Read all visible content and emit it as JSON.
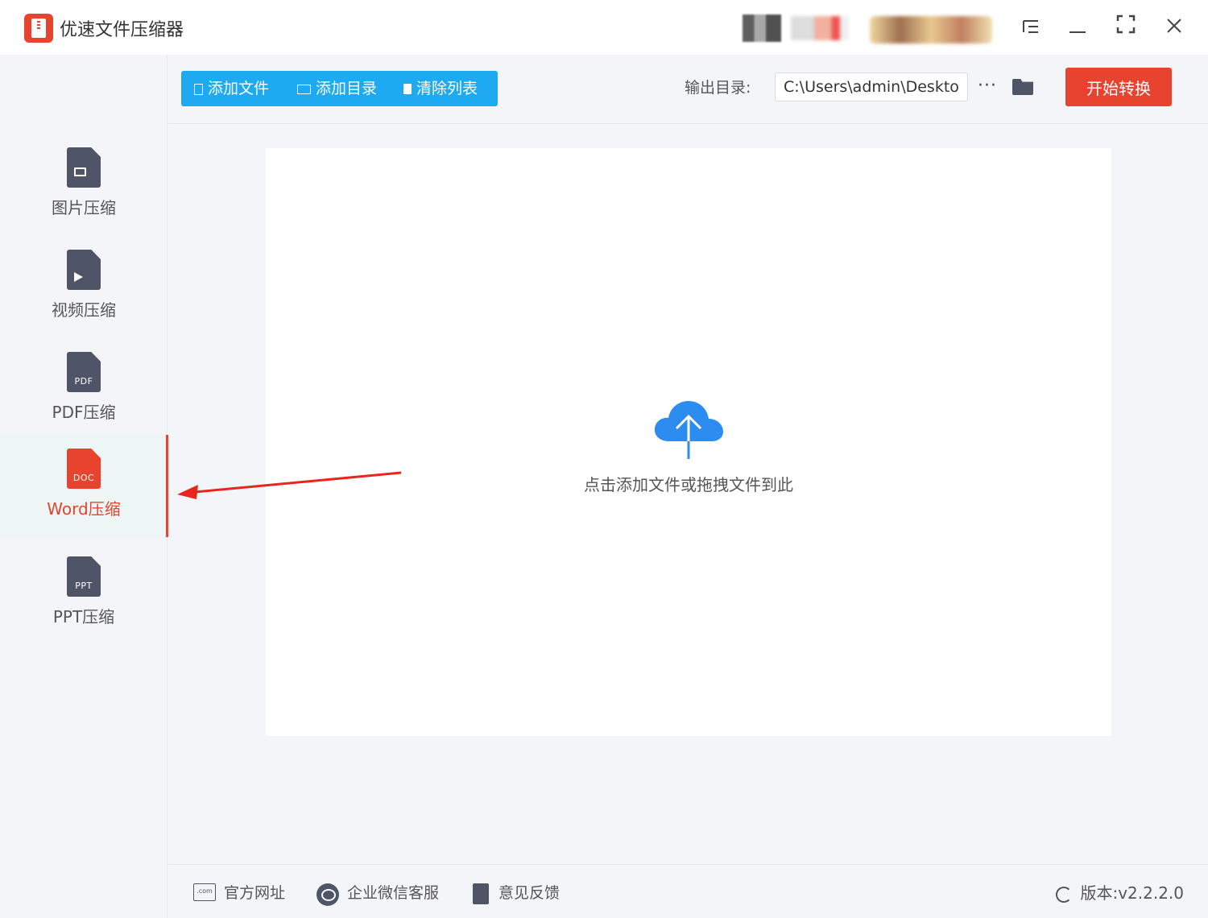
{
  "app": {
    "title": "优速文件压缩器"
  },
  "window_controls": {
    "menu_icon": "list-menu-icon",
    "minimize_icon": "minimize-icon",
    "maximize_icon": "maximize-icon",
    "close_icon": "close-icon"
  },
  "sidebar": {
    "items": [
      {
        "label": "图片压缩",
        "icon": "image-file-icon",
        "tag": "",
        "active": false
      },
      {
        "label": "视频压缩",
        "icon": "video-file-icon",
        "tag": "",
        "active": false
      },
      {
        "label": "PDF压缩",
        "icon": "pdf-file-icon",
        "tag": "PDF",
        "active": false
      },
      {
        "label": "Word压缩",
        "icon": "doc-file-icon",
        "tag": "DOC",
        "active": true
      },
      {
        "label": "PPT压缩",
        "icon": "ppt-file-icon",
        "tag": "PPT",
        "active": false
      }
    ]
  },
  "toolbar": {
    "add_file": "添加文件",
    "add_folder": "添加目录",
    "clear_list": "清除列表",
    "output_label": "输出目录:",
    "output_path": "C:\\Users\\admin\\Deskto",
    "more": "···",
    "start": "开始转换"
  },
  "dropzone": {
    "icon": "cloud-upload-icon",
    "text": "点击添加文件或拖拽文件到此"
  },
  "footer": {
    "website": "官方网址",
    "website_icon_text": ".com",
    "wechat": "企业微信客服",
    "feedback": "意见反馈",
    "version": "版本:v2.2.2.0"
  },
  "colors": {
    "accent_red": "#e8432e",
    "toolbar_blue": "#1eaaf1",
    "cloud_blue": "#2d8cf0",
    "icon_gray": "#4f5566"
  }
}
